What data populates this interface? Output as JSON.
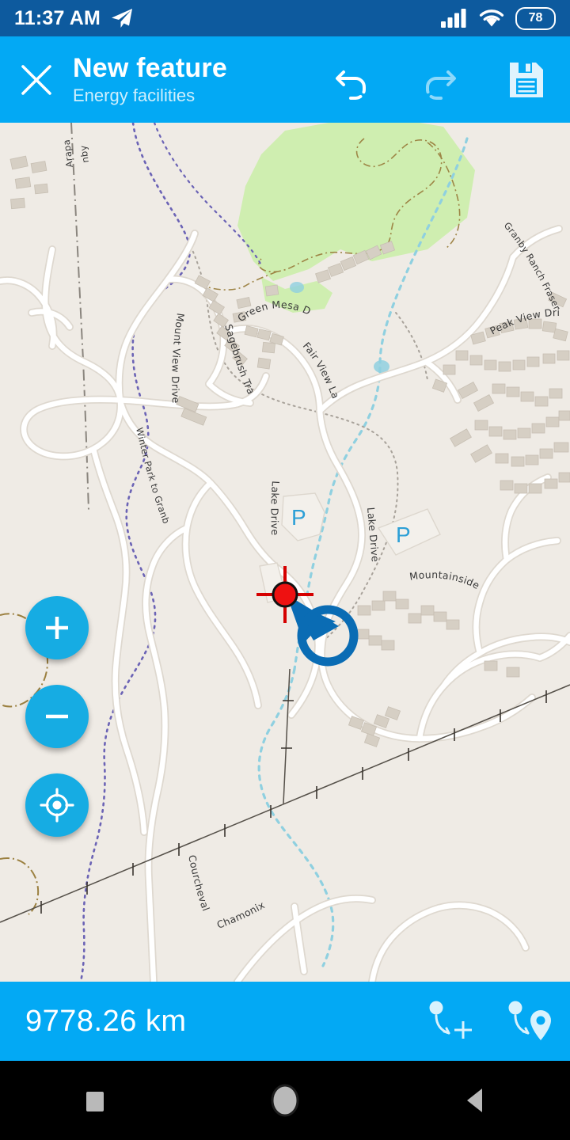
{
  "statusbar": {
    "time": "11:37 AM",
    "telegram_icon": "send-icon",
    "signal_icon": "signal-bars-icon",
    "wifi_icon": "wifi-icon",
    "battery_level": "78",
    "battery_icon": "battery-icon"
  },
  "toolbar": {
    "close_icon": "close-icon",
    "title": "New feature",
    "subtitle": "Energy facilities",
    "undo_icon": "undo-icon",
    "redo_icon": "redo-icon",
    "save_icon": "save-icon"
  },
  "map": {
    "zoom_in_icon": "plus-icon",
    "zoom_out_icon": "minus-icon",
    "my_location_icon": "my-location-icon",
    "crosshair_icon": "crosshair-marker-icon",
    "vertex_icon": "red-vertex-icon",
    "pointer_icon": "balloon-pointer-icon",
    "parking_label": "P",
    "street_labels": [
      "Mount View Drive",
      "Sagebrush Trail",
      "Green Mesa Drive",
      "Fair View Lane",
      "Lake Drive",
      "Peak View Drive",
      "Mountainside Drive",
      "Granby Ranch Fraser Canyon Trail",
      "Winter Park to Granby Trail",
      "Courcheval Street",
      "Chamonix Street",
      "Arapa",
      "nby"
    ],
    "colors": {
      "land": "#efebe5",
      "park": "#cfeeb0",
      "road": "#ffffff",
      "building": "#d6cfc4",
      "water": "#8fd0e0",
      "powerline": "#555049",
      "trail_purple": "#6b63b5",
      "trail_brown": "#9b8040",
      "accent": "#03a9f4",
      "vertex_red": "#ee1111",
      "pointer_blue": "#0a6cb4"
    }
  },
  "bottombar": {
    "distance": "9778.26 km",
    "add_node_crosshair_icon": "add-node-at-crosshair-icon",
    "add_node_location_icon": "add-node-at-location-icon"
  },
  "navbar": {
    "recents_icon": "recents-square-icon",
    "home_icon": "home-circle-icon",
    "back_icon": "back-triangle-icon"
  }
}
